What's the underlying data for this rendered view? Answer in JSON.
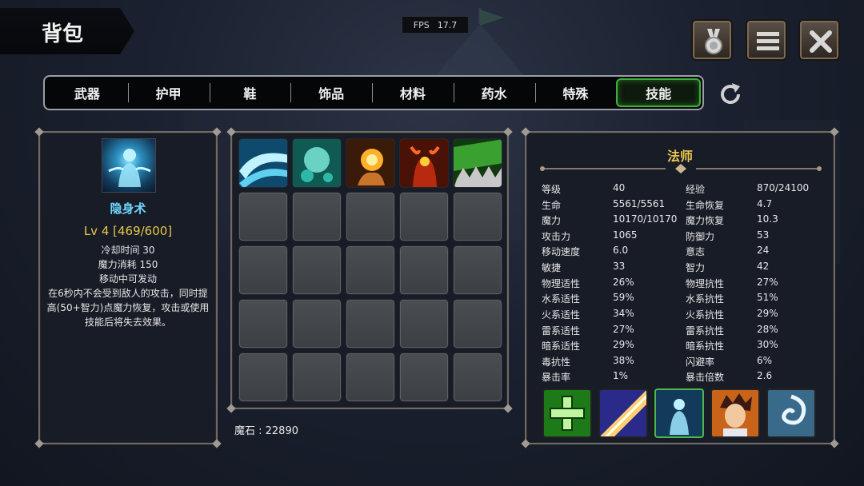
{
  "title": "背包",
  "fps": {
    "label": "FPS",
    "value": "17.7"
  },
  "top_buttons": [
    {
      "icon": "medal-icon"
    },
    {
      "icon": "menu-icon"
    },
    {
      "icon": "close-icon"
    }
  ],
  "tabs": [
    {
      "label": "武器"
    },
    {
      "label": "护甲"
    },
    {
      "label": "鞋"
    },
    {
      "label": "饰品"
    },
    {
      "label": "材料"
    },
    {
      "label": "药水"
    },
    {
      "label": "特殊"
    },
    {
      "label": "技能",
      "active": true
    }
  ],
  "skill": {
    "name": "隐身术",
    "level": "Lv 4 [469/600]",
    "cooldown": "冷却时间 30",
    "mana_cost": "魔力消耗 150",
    "movable": "移动中可发动",
    "description": "在6秒内不会受到敌人的攻击，同时提高(50+智力)点魔力恢复，攻击或使用技能后将失去效果。"
  },
  "inventory": {
    "skills": [
      "water-wave-skill-icon",
      "ice-burst-skill-icon",
      "fire-palm-skill-icon",
      "demon-skill-icon",
      "thorn-skill-icon"
    ],
    "empty_slot_count": 20,
    "currency": "魔石 : 22890"
  },
  "character": {
    "class_name": "法师",
    "stats_left": [
      {
        "label": "等级",
        "value": "40"
      },
      {
        "label": "生命",
        "value": "5561/5561"
      },
      {
        "label": "魔力",
        "value": "10170/10170"
      },
      {
        "label": "攻击力",
        "value": "1065"
      },
      {
        "label": "移动速度",
        "value": "6.0"
      },
      {
        "label": "敏捷",
        "value": "33"
      },
      {
        "label": "物理适性",
        "value": "26%"
      },
      {
        "label": "水系适性",
        "value": "59%"
      },
      {
        "label": "火系适性",
        "value": "34%"
      },
      {
        "label": "雷系适性",
        "value": "27%"
      },
      {
        "label": "暗系适性",
        "value": "29%"
      },
      {
        "label": "毒抗性",
        "value": "38%"
      },
      {
        "label": "暴击率",
        "value": "1%"
      }
    ],
    "stats_right": [
      {
        "label": "经验",
        "value": "870/24100"
      },
      {
        "label": "生命恢复",
        "value": "4.7"
      },
      {
        "label": "魔力恢复",
        "value": "10.3"
      },
      {
        "label": "防御力",
        "value": "53"
      },
      {
        "label": "意志",
        "value": "24"
      },
      {
        "label": "智力",
        "value": "42"
      },
      {
        "label": "物理抗性",
        "value": "27%"
      },
      {
        "label": "水系抗性",
        "value": "51%"
      },
      {
        "label": "火系抗性",
        "value": "29%"
      },
      {
        "label": "雷系抗性",
        "value": "28%"
      },
      {
        "label": "暗系抗性",
        "value": "30%"
      },
      {
        "label": "闪避率",
        "value": "6%"
      },
      {
        "label": "暴击倍数",
        "value": "2.6"
      }
    ],
    "equipped_skills": [
      "heal-cross-icon",
      "light-beam-icon",
      "stealth-figure-icon",
      "hero-portrait-icon",
      "whirlwind-icon"
    ]
  },
  "colors": {
    "active_tab_border": "#3fae3a",
    "skill_name": "#6fd6ff",
    "gold_text": "#e8c64a"
  }
}
